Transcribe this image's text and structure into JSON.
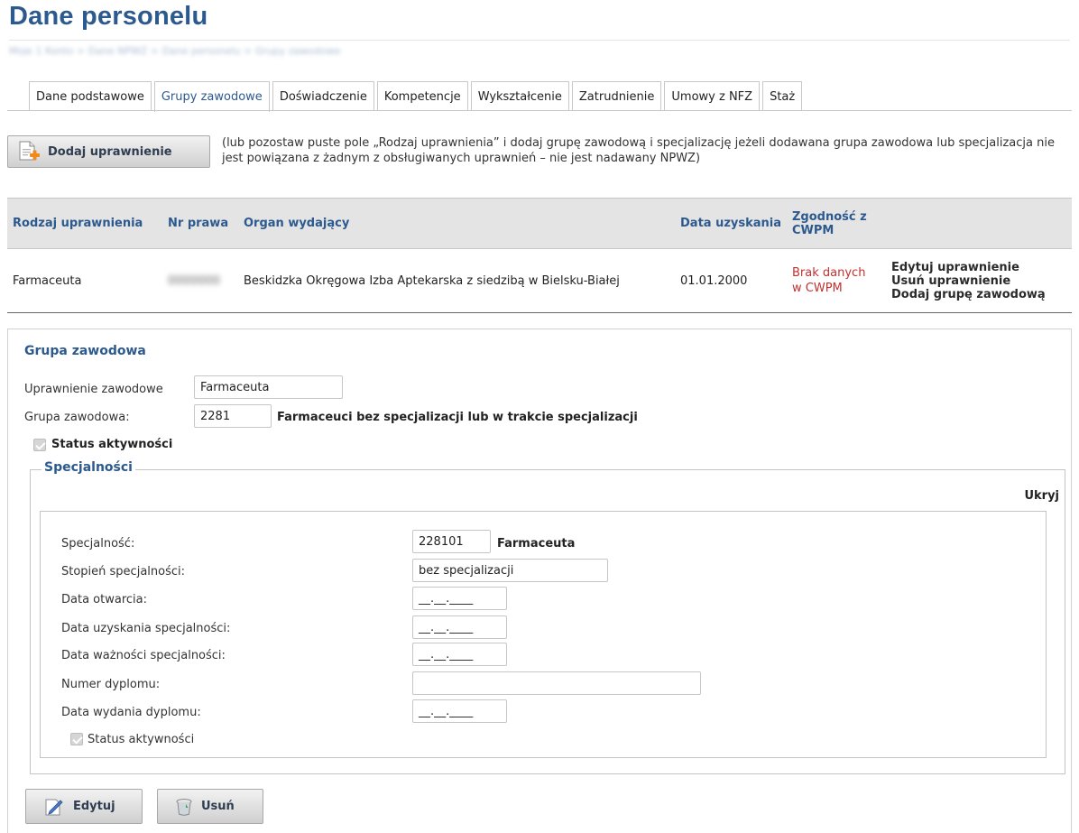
{
  "page": {
    "title": "Dane personelu",
    "breadcrumb": "Moje 1 Konto > Dane NPWZ > Dane personelu > Grupy zawodowe"
  },
  "tabs": [
    {
      "label": "Dane podstawowe",
      "active": false
    },
    {
      "label": "Grupy zawodowe",
      "active": true
    },
    {
      "label": "Doświadczenie",
      "active": false
    },
    {
      "label": "Kompetencje",
      "active": false
    },
    {
      "label": "Wykształcenie",
      "active": false
    },
    {
      "label": "Zatrudnienie",
      "active": false
    },
    {
      "label": "Umowy z NFZ",
      "active": false
    },
    {
      "label": "Staż",
      "active": false
    }
  ],
  "add_section": {
    "button_label": "Dodaj uprawnienie",
    "info_text": "(lub pozostaw puste pole „Rodzaj uprawnienia” i dodaj grupę zawodową i specjalizację jeżeli dodawana grupa zawodowa lub specjalizacja nie jest powiązana z żadnym z obsługiwanych uprawnień – nie jest nadawany NPWZ)"
  },
  "table": {
    "headers": {
      "rodzaj": "Rodzaj uprawnienia",
      "nr": "Nr prawa",
      "organ": "Organ wydający",
      "data": "Data uzyskania",
      "zgodnosc": "Zgodność z CWPM"
    },
    "row": {
      "rodzaj": "Farmaceuta",
      "nr": "0000000",
      "organ": "Beskidzka Okręgowa Izba Aptekarska z siedzibą w Bielsku-Białej",
      "data": "01.01.2000",
      "zgodnosc": "Brak danych w CWPM",
      "actions": {
        "edit": "Edytuj uprawnienie",
        "delete": "Usuń uprawnienie",
        "add_group": "Dodaj grupę zawodową"
      }
    }
  },
  "group": {
    "section_title": "Grupa zawodowa",
    "uprawnienie_label": "Uprawnienie zawodowe",
    "uprawnienie_value": "Farmaceuta",
    "grupa_label": "Grupa zawodowa:",
    "grupa_code": "2281",
    "grupa_name": "Farmaceuci bez specjalizacji lub w trakcie specjalizacji",
    "status_label": "Status aktywności"
  },
  "specs": {
    "legend": "Specjalności",
    "hide_label": "Ukryj",
    "specjalnosc_label": "Specjalność:",
    "specjalnosc_code": "228101",
    "specjalnosc_name": "Farmaceuta",
    "stopien_label": "Stopień specjalności:",
    "stopien_value": "bez specjalizacji",
    "data_otwarcia_label": "Data otwarcia:",
    "data_uzyskania_label": "Data uzyskania specjalności:",
    "data_waznosci_label": "Data ważności specjalności:",
    "numer_dyplomu_label": "Numer dyplomu:",
    "data_wydania_label": "Data wydania dyplomu:",
    "date_mask": "__.__.____",
    "status_label": "Status aktywności"
  },
  "buttons": {
    "edit": "Edytuj",
    "delete": "Usuń"
  }
}
